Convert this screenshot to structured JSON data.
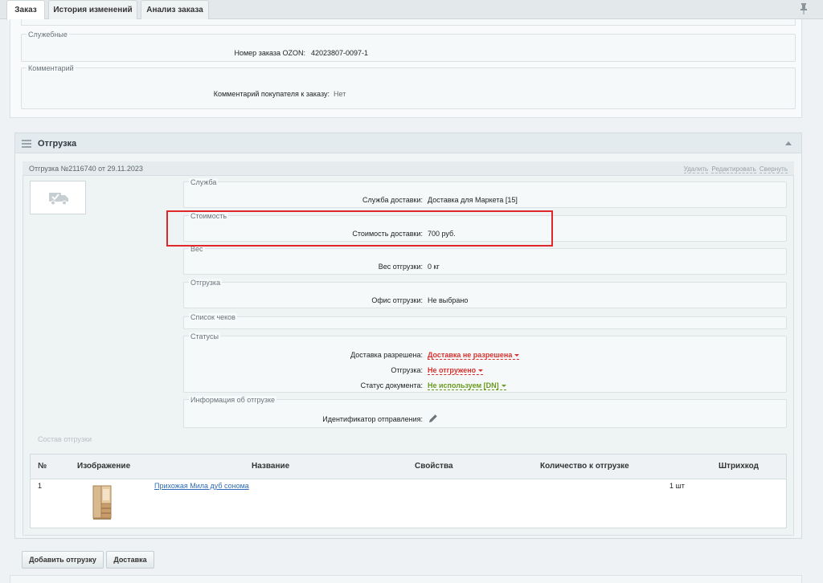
{
  "tabs": [
    {
      "label": "Заказ",
      "active": true
    },
    {
      "label": "История изменений",
      "active": false
    },
    {
      "label": "Анализ заказа",
      "active": false
    }
  ],
  "service_block": {
    "legend": "Служебные",
    "label": "Номер заказа OZON:",
    "value": "42023807-0097-1"
  },
  "comment_block": {
    "legend": "Комментарий",
    "label": "Комментарий покупателя к заказу:",
    "value": "Нет"
  },
  "shipment": {
    "title": "Отгрузка",
    "number": "Отгрузка №2116740 от 29.11.2023",
    "actions": [
      "Удалить",
      "Редактировать",
      "Свернуть"
    ],
    "service": {
      "legend": "Служба",
      "label": "Служба доставки:",
      "value": "Доставка для Маркета [15]"
    },
    "cost": {
      "legend": "Стоимость",
      "label": "Стоимость доставки:",
      "value": "700 руб."
    },
    "weight": {
      "legend": "Вес",
      "label": "Вес отгрузки:",
      "value": "0 кг"
    },
    "shipping": {
      "legend": "Отгрузка",
      "label": "Офис отгрузки:",
      "value": "Не выбрано"
    },
    "receipts": {
      "legend": "Список чеков"
    },
    "statuses": {
      "legend": "Статусы",
      "rows": [
        {
          "label": "Доставка разрешена:",
          "value": "Доставка не разрешена",
          "color": "#d8312d"
        },
        {
          "label": "Отгрузка:",
          "value": "Не отгружено",
          "color": "#d8312d"
        },
        {
          "label": "Статус документа:",
          "value": "Не используем [DN]",
          "color": "#6a9a1c"
        }
      ]
    },
    "info": {
      "legend": "Информация об отгрузке",
      "label": "Идентификатор отправления:"
    },
    "composition_label": "Состав отгрузки",
    "table": {
      "headers": [
        "№",
        "Изображение",
        "Название",
        "Свойства",
        "Количество к отгрузке",
        "Штрихкод"
      ],
      "rows": [
        {
          "num": "1",
          "name": "Прихожая Мила дуб сонома",
          "props": "",
          "qty": "1 шт",
          "barcode": ""
        }
      ]
    }
  },
  "buttons": {
    "add_shipment": "Добавить отгрузку",
    "delivery": "Доставка"
  },
  "icons": [
    "pin-icon",
    "hamburger-icon",
    "truck-icon",
    "pencil-icon"
  ],
  "highlight_color": "#e0282a"
}
